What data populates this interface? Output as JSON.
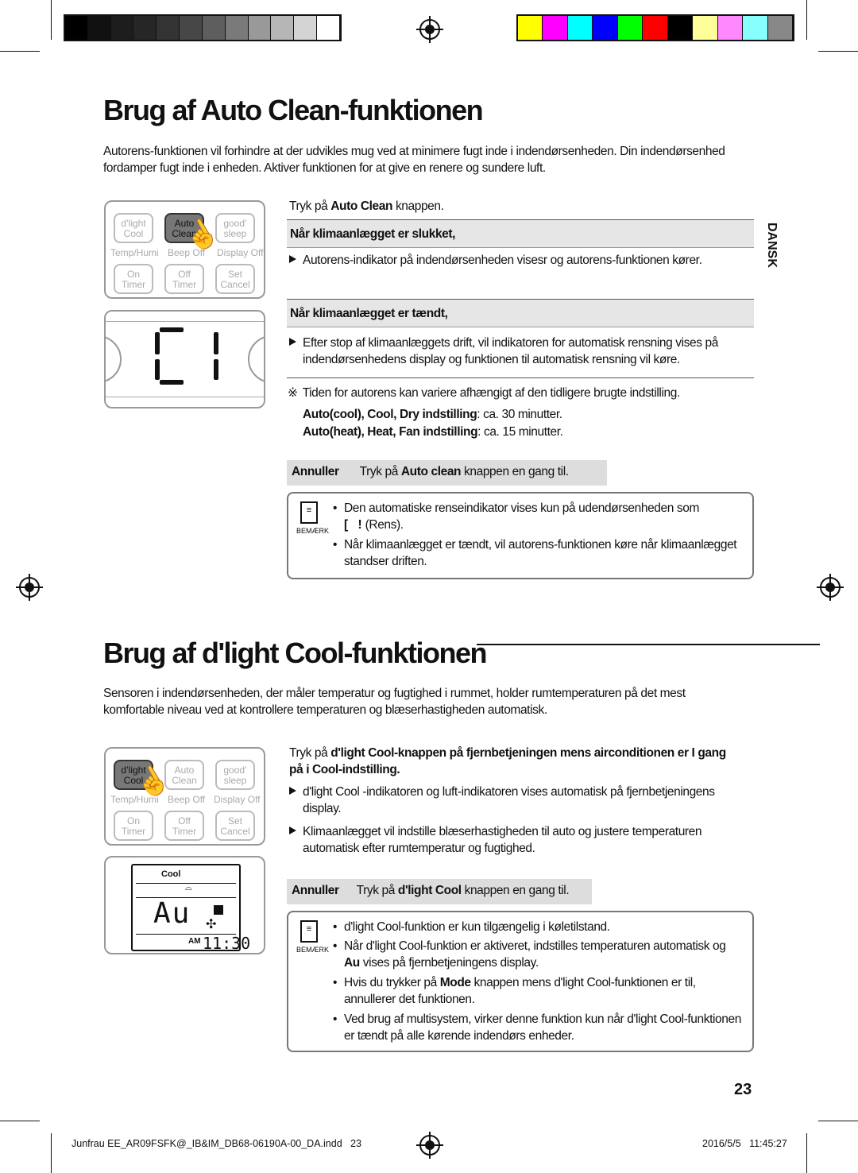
{
  "colors": {
    "grays": [
      "#000",
      "#111",
      "#1d1d1d",
      "#262626",
      "#333",
      "#474747",
      "#5e5e5e",
      "#7a7a7a",
      "#999",
      "#b6b6b6",
      "#d4d4d4",
      "#fff"
    ],
    "swatches": [
      "#ffff00",
      "#ff00ff",
      "#00ffff",
      "#0000ff",
      "#00ff00",
      "#ff0000",
      "#000000",
      "#ffff99",
      "#ff88ff",
      "#88ffff",
      "#888888"
    ]
  },
  "section1": {
    "title": "Brug af Auto Clean-funktionen",
    "intro": "Autorens-funktionen vil forhindre at der udvikles mug ved at minimere fugt inde i indendørsenheden. Din indendørsenhed fordamper fugt inde i enheden. Aktiver funktionen for at give en renere og sundere luft.",
    "step": {
      "pre": "Tryk på ",
      "bold": "Auto Clean",
      "post": " knappen."
    },
    "header_off": "Når klimaanlægget er slukket,",
    "off_text": "Autorens-indikator på indendørsenheden visesr og autorens-funktionen kører.",
    "header_on": "Når klimaanlægget er tændt,",
    "on_text": "Efter stop af klimaanlæggets drift, vil indikatoren for automatisk rensning vises på indendørsenhedens display og funktionen til automatisk rensning vil køre.",
    "note_symbol": "※",
    "time_note": "Tiden for autorens kan variere afhængigt af den tidligere brugte indstilling.",
    "time1": {
      "bold": "Auto(cool), Cool, Dry indstilling",
      "post": ": ca. 30 minutter."
    },
    "time2": {
      "bold": "Auto(heat), Heat, Fan  indstilling",
      "post": ": ca. 15 minutter."
    },
    "cancel": {
      "label": "Annuller",
      "pre": "Tryk på ",
      "bold": "Auto clean",
      "post": " knappen en gang til."
    },
    "remark_label": "BEMÆRK",
    "remarks": [
      "Den automatiske renseindikator vises kun på udendørsenheden som",
      "(Rens).",
      "Når klimaanlægget er tændt, vil autorens-funktionen køre når klimaanlægget standser driften."
    ],
    "display": "C1"
  },
  "remote": {
    "buttons": [
      [
        "d’light",
        "Cool"
      ],
      [
        "Auto",
        "Clean"
      ],
      [
        "good’",
        "sleep"
      ],
      [
        "On",
        "Timer"
      ],
      [
        "Off",
        "Timer"
      ],
      [
        "Set",
        "Cancel"
      ]
    ],
    "labels": [
      "Temp/Humi",
      "Beep Off",
      "Display Off"
    ]
  },
  "side_label": "DANSK",
  "section2": {
    "title": "Brug af d'light Cool-funktionen",
    "intro": "Sensoren i indendørsenheden, der måler temperatur og fugtighed i rummet, holder rumtemperaturen på det mest komfortable niveau ved at kontrollere temperaturen og blæserhastigheden automatisk.",
    "step": {
      "pre": "Tryk på ",
      "bold": "d'light Cool",
      "post": "-knappen på fjernbetjeningen mens airconditionen er I gang på i Cool-indstilling."
    },
    "bullets": [
      "d'light Cool -indikatoren og luft-indikatoren vises automatisk på fjernbetjeningens display.",
      "Klimaanlægget vil indstille blæserhastigheden til auto og justere temperaturen automatisk efter rumtemperatur og fugtighed."
    ],
    "cancel": {
      "label": "Annuller",
      "pre": "Tryk på ",
      "bold": "d'light Cool",
      "post": " knappen en gang til."
    },
    "remarks": [
      "d'light Cool-funktion er kun tilgængelig i køletilstand.",
      "Når d'light Cool-funktion er aktiveret, indstilles temperaturen automatisk og",
      "vises på fjernbetjeningens display.",
      "Hvis du trykker på ",
      "Mode",
      " knappen mens d'light Cool-funktionen er til, annullerer det funktionen.",
      "Ved brug af multisystem, virker denne funktion kun når d'light Cool-funktionen er tændt på alle kørende indendørs enheder."
    ],
    "lcd": {
      "mode": "Cool",
      "main": "Au",
      "ampm": "AM",
      "time": "11:30"
    }
  },
  "page_number": "23",
  "footer": {
    "file": "Junfrau EE_AR09FSFK@_IB&IM_DB68-06190A-00_DA.indd   23",
    "date": "2016/5/5   11:45:27"
  }
}
